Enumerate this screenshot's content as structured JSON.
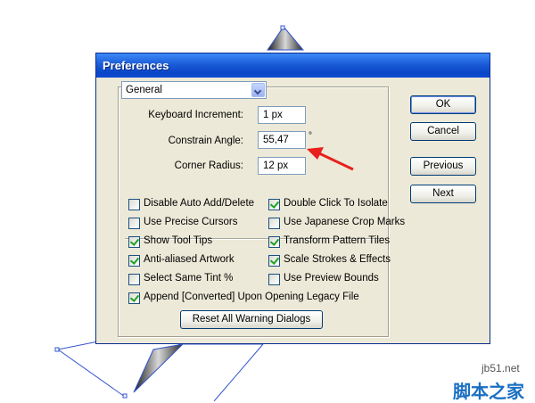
{
  "window": {
    "title": "Preferences"
  },
  "panel_select": {
    "selected": "General"
  },
  "fields": {
    "keyboard_increment": {
      "label": "Keyboard Increment:",
      "value": "1 px"
    },
    "constrain_angle": {
      "label": "Constrain Angle:",
      "value": "55,47",
      "note": "°"
    },
    "corner_radius": {
      "label": "Corner Radius:",
      "value": "12 px"
    }
  },
  "checkboxes": [
    {
      "label": "Disable Auto Add/Delete",
      "checked": false
    },
    {
      "label": "Double Click To Isolate",
      "checked": true
    },
    {
      "label": "Use Precise Cursors",
      "checked": false
    },
    {
      "label": "Use Japanese Crop Marks",
      "checked": false
    },
    {
      "label": "Show Tool Tips",
      "checked": true
    },
    {
      "label": "Transform Pattern Tiles",
      "checked": true
    },
    {
      "label": "Anti-aliased Artwork",
      "checked": true
    },
    {
      "label": "Scale Strokes & Effects",
      "checked": true
    },
    {
      "label": "Select Same Tint %",
      "checked": false
    },
    {
      "label": "Use Preview Bounds",
      "checked": false
    },
    {
      "label": "Append [Converted] Upon Opening Legacy File",
      "checked": true
    }
  ],
  "buttons": {
    "reset": "Reset All Warning Dialogs",
    "ok": "OK",
    "cancel": "Cancel",
    "previous": "Previous",
    "next": "Next"
  },
  "watermark": {
    "site": "jb51.net",
    "brand": "脚本之家"
  },
  "colors": {
    "titlebar": "#0a46c8",
    "dialog_bg": "#ece9d8",
    "arrow": "#e8201c",
    "check": "#21a121"
  }
}
